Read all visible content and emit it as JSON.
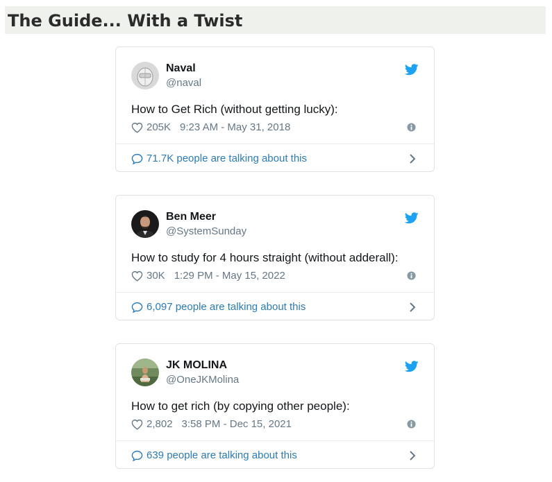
{
  "page": {
    "title": "The Guide... With a Twist"
  },
  "tweets": [
    {
      "name": "Naval",
      "handle": "@naval",
      "text": "How to Get Rich (without getting lucky):",
      "likes": "205K",
      "timestamp": "9:23 AM - May 31, 2018",
      "talking": "71.7K people are talking about this",
      "avatar_icon": "robot-avatar"
    },
    {
      "name": "Ben Meer",
      "handle": "@SystemSunday",
      "text": "How to study for 4 hours straight (without adderall):",
      "likes": "30K",
      "timestamp": "1:29 PM - May 15, 2022",
      "talking": "6,097 people are talking about this",
      "avatar_icon": "person-avatar"
    },
    {
      "name": "JK MOLINA",
      "handle": "@OneJKMolina",
      "text": "How to get rich (by copying other people):",
      "likes": "2,802",
      "timestamp": "3:58 PM - Dec 15, 2021",
      "talking": "639 people are talking about this",
      "avatar_icon": "person-outdoor-avatar"
    }
  ],
  "colors": {
    "twitter_blue": "#1da1f2",
    "link_blue": "#2b7bb9",
    "muted": "#657786",
    "header_bg": "#eef1ec"
  }
}
